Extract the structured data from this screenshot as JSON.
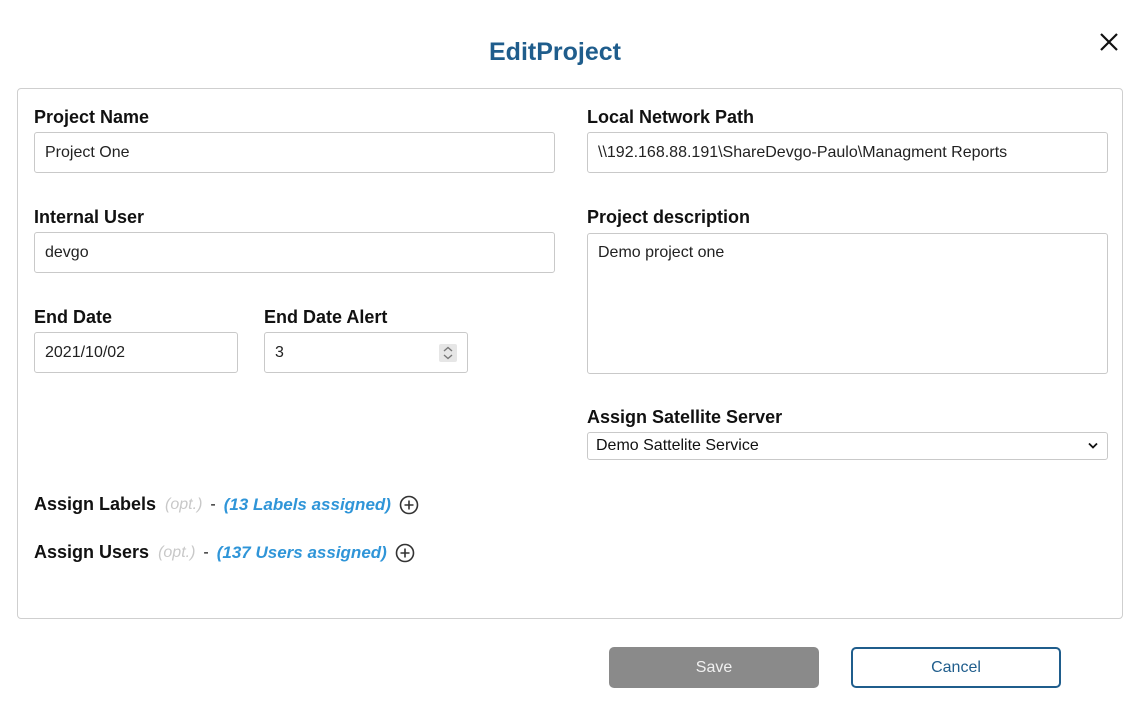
{
  "dialog": {
    "title": "EditProject"
  },
  "form": {
    "project_name": {
      "label": "Project Name",
      "value": "Project One"
    },
    "local_network_path": {
      "label": "Local Network Path",
      "value": "\\\\192.168.88.191\\ShareDevgo-Paulo\\Managment Reports"
    },
    "internal_user": {
      "label": "Internal User",
      "value": "devgo"
    },
    "project_description": {
      "label": "Project description",
      "value": "Demo project one"
    },
    "end_date": {
      "label": "End Date",
      "value": "2021/10/02"
    },
    "end_date_alert": {
      "label": "End Date Alert",
      "value": "3"
    },
    "satellite_server": {
      "label": "Assign Satellite Server",
      "selected": "Demo Sattelite Service"
    },
    "labels": {
      "label": "Assign Labels",
      "opt": "(opt.)",
      "dash": "-",
      "count_text": "(13 Labels assigned)"
    },
    "users": {
      "label": "Assign Users",
      "opt": "(opt.)",
      "dash": "-",
      "count_text": "(137 Users assigned)"
    }
  },
  "buttons": {
    "save": "Save",
    "cancel": "Cancel"
  },
  "icons": {
    "close": "close-icon",
    "add": "plus-circle-icon",
    "spinner": "spin-arrows-icon",
    "dropdown": "chevron-down-icon"
  },
  "colors": {
    "title": "#1f5d8c",
    "link": "#2f95d8",
    "save_bg": "#8a8a8a",
    "cancel_border": "#1f5d8c"
  }
}
